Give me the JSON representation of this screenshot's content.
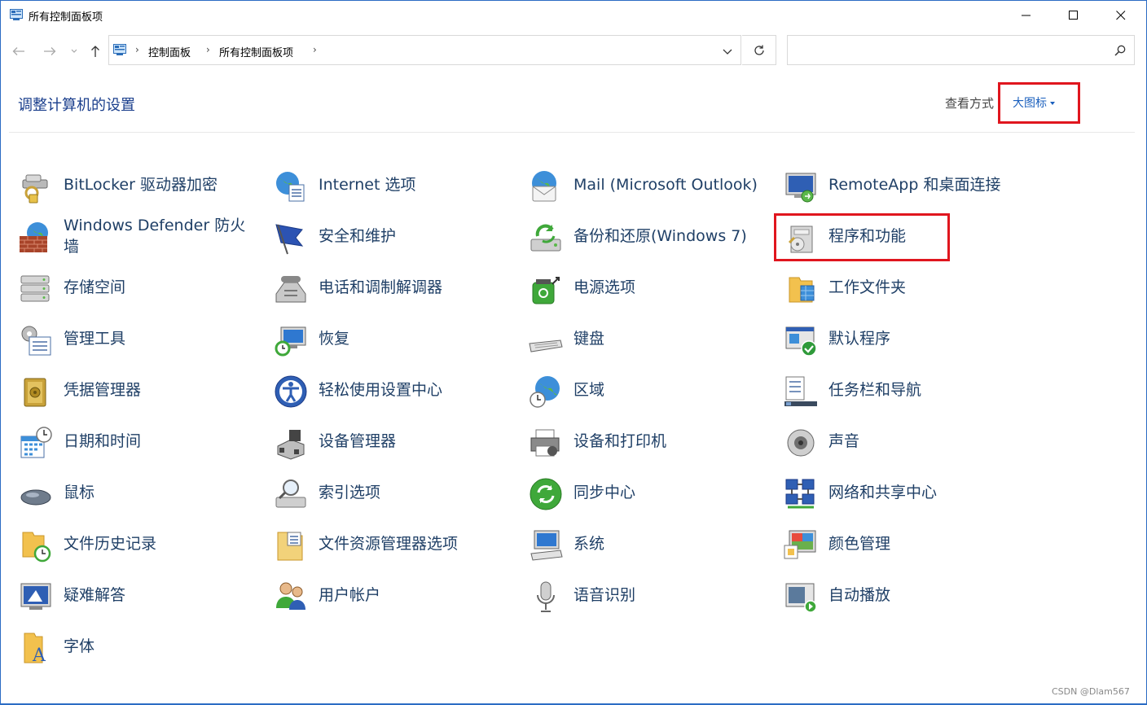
{
  "window": {
    "title": "所有控制面板项",
    "minimize_icon": "minimize-icon",
    "maximize_icon": "maximize-icon",
    "close_icon": "close-icon"
  },
  "address": {
    "crumbs": [
      "控制面板",
      "所有控制面板项"
    ],
    "search_placeholder": ""
  },
  "header": {
    "title": "调整计算机的设置",
    "view_label": "查看方式",
    "view_value": "大图标"
  },
  "items": [
    {
      "label": "BitLocker 驱动器加密",
      "icon": "bitlocker-icon"
    },
    {
      "label": "Internet 选项",
      "icon": "internet-options-icon"
    },
    {
      "label": "Mail (Microsoft Outlook)",
      "icon": "mail-icon"
    },
    {
      "label": "RemoteApp 和桌面连接",
      "icon": "remoteapp-icon"
    },
    {
      "label": "Windows Defender 防火墙",
      "icon": "firewall-icon"
    },
    {
      "label": "安全和维护",
      "icon": "security-flag-icon"
    },
    {
      "label": "备份和还原(Windows 7)",
      "icon": "backup-icon"
    },
    {
      "label": "程序和功能",
      "icon": "programs-icon"
    },
    {
      "label": "存储空间",
      "icon": "storage-icon"
    },
    {
      "label": "电话和调制解调器",
      "icon": "phone-modem-icon"
    },
    {
      "label": "电源选项",
      "icon": "power-icon"
    },
    {
      "label": "工作文件夹",
      "icon": "work-folders-icon"
    },
    {
      "label": "管理工具",
      "icon": "admin-tools-icon"
    },
    {
      "label": "恢复",
      "icon": "recovery-icon"
    },
    {
      "label": "键盘",
      "icon": "keyboard-icon"
    },
    {
      "label": "默认程序",
      "icon": "default-programs-icon"
    },
    {
      "label": "凭据管理器",
      "icon": "credential-icon"
    },
    {
      "label": "轻松使用设置中心",
      "icon": "ease-of-access-icon"
    },
    {
      "label": "区域",
      "icon": "region-icon"
    },
    {
      "label": "任务栏和导航",
      "icon": "taskbar-icon"
    },
    {
      "label": "日期和时间",
      "icon": "datetime-icon"
    },
    {
      "label": "设备管理器",
      "icon": "device-manager-icon"
    },
    {
      "label": "设备和打印机",
      "icon": "printer-icon"
    },
    {
      "label": "声音",
      "icon": "sound-icon"
    },
    {
      "label": "鼠标",
      "icon": "mouse-icon"
    },
    {
      "label": "索引选项",
      "icon": "indexing-icon"
    },
    {
      "label": "同步中心",
      "icon": "sync-icon"
    },
    {
      "label": "网络和共享中心",
      "icon": "network-icon"
    },
    {
      "label": "文件历史记录",
      "icon": "file-history-icon"
    },
    {
      "label": "文件资源管理器选项",
      "icon": "explorer-options-icon"
    },
    {
      "label": "系统",
      "icon": "system-icon"
    },
    {
      "label": "颜色管理",
      "icon": "color-management-icon"
    },
    {
      "label": "疑难解答",
      "icon": "troubleshoot-icon"
    },
    {
      "label": "用户帐户",
      "icon": "user-accounts-icon"
    },
    {
      "label": "语音识别",
      "icon": "speech-icon"
    },
    {
      "label": "自动播放",
      "icon": "autoplay-icon"
    },
    {
      "label": "字体",
      "icon": "fonts-icon"
    }
  ],
  "watermark": "CSDN @Dlam567",
  "colors": {
    "link": "#1f3f66",
    "title": "#1a3e8c",
    "highlight": "#e0161e"
  }
}
